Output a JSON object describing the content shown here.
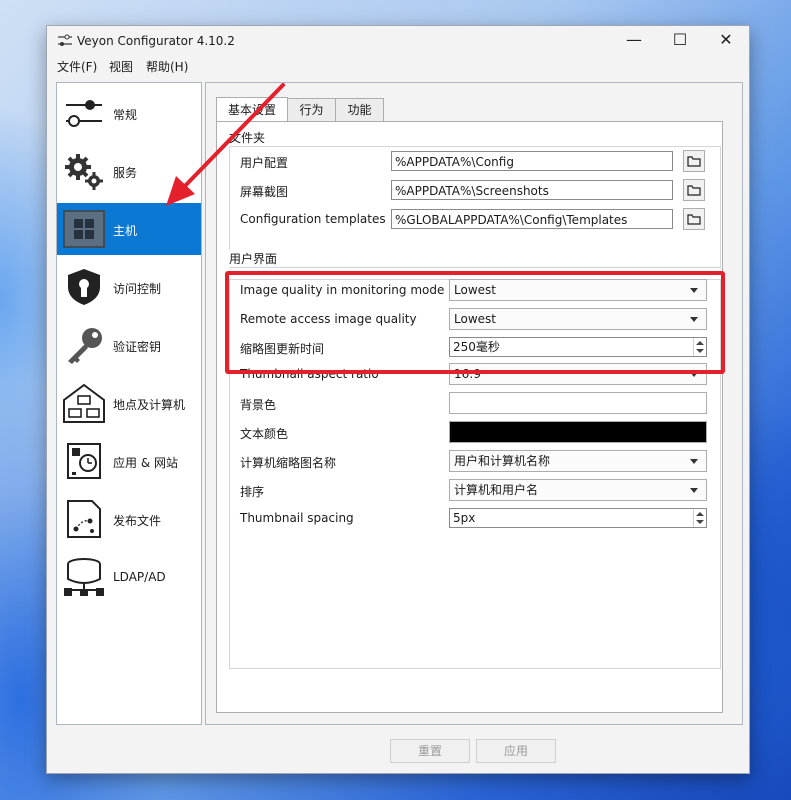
{
  "window": {
    "title": "Veyon Configurator 4.10.2",
    "minimize": "—",
    "maximize": "☐",
    "close": "✕"
  },
  "menu": [
    "文件(F)",
    "视图",
    "帮助(H)"
  ],
  "sidebar": {
    "items": [
      {
        "label": "常规",
        "icon": "sliders-icon"
      },
      {
        "label": "服务",
        "icon": "gears-icon"
      },
      {
        "label": "主机",
        "icon": "grid-monitor-icon"
      },
      {
        "label": "访问控制",
        "icon": "shield-lock-icon"
      },
      {
        "label": "验证密钥",
        "icon": "key-icon"
      },
      {
        "label": "地点及计算机",
        "icon": "house-computers-icon"
      },
      {
        "label": "应用 & 网站",
        "icon": "app-clock-icon"
      },
      {
        "label": "发布文件",
        "icon": "file-transfer-icon"
      },
      {
        "label": "LDAP/AD",
        "icon": "database-network-icon"
      }
    ],
    "active_index": 2
  },
  "tabs": [
    "基本设置",
    "行为",
    "功能"
  ],
  "folders": {
    "title": "文件夹",
    "rows": [
      {
        "label": "用户配置",
        "value": "%APPDATA%\\Config"
      },
      {
        "label": "屏幕截图",
        "value": "%APPDATA%\\Screenshots"
      },
      {
        "label": "Configuration templates",
        "value": "%GLOBALAPPDATA%\\Config\\Templates"
      }
    ]
  },
  "ui": {
    "title": "用户界面",
    "image_quality_label": "Image quality in monitoring mode",
    "image_quality_value": "Lowest",
    "remote_quality_label": "Remote access image quality",
    "remote_quality_value": "Lowest",
    "thumb_update_label": "缩略图更新时间",
    "thumb_update_value": "250毫秒",
    "aspect_label": "Thumbnail aspect ratio",
    "aspect_value": "16:9",
    "bg_label": "背景色",
    "bg_color": "#ffffff",
    "text_color_label": "文本颜色",
    "text_color": "#000000",
    "caption_label": "计算机缩略图名称",
    "caption_value": "用户和计算机名称",
    "sort_label": "排序",
    "sort_value": "计算机和用户名",
    "spacing_label": "Thumbnail spacing",
    "spacing_value": "5px"
  },
  "footer": {
    "reset": "重置",
    "apply": "应用"
  },
  "colors": {
    "accent": "#0b78d4",
    "highlight": "#e3202b"
  }
}
